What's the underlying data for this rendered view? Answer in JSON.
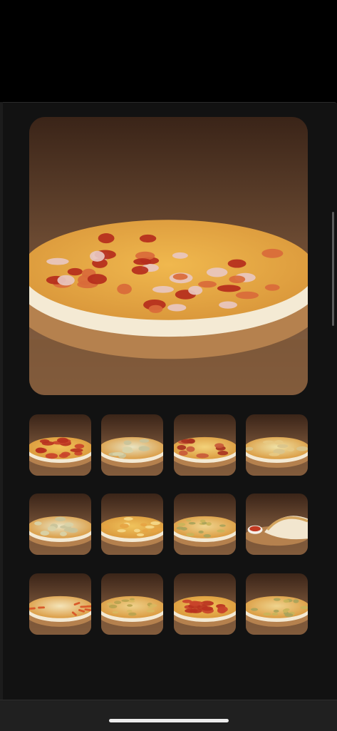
{
  "gallery": {
    "main_photo": {
      "icon": "pizza-photo",
      "topping": "pepperoni-onion"
    },
    "thumbnails": [
      {
        "icon": "pizza-photo",
        "topping": "pepperoni"
      },
      {
        "icon": "pizza-photo",
        "topping": "white-cheese"
      },
      {
        "icon": "pizza-photo",
        "topping": "salami"
      },
      {
        "icon": "pizza-photo",
        "topping": "four-cheese"
      },
      {
        "icon": "pizza-photo",
        "topping": "white-cheese"
      },
      {
        "icon": "pizza-photo",
        "topping": "cheese"
      },
      {
        "icon": "pizza-photo",
        "topping": "cheese-herb"
      },
      {
        "icon": "calzone-photo",
        "topping": "calzone"
      },
      {
        "icon": "pizza-photo",
        "topping": "sauce-stripes"
      },
      {
        "icon": "pizza-photo",
        "topping": "veggie"
      },
      {
        "icon": "pizza-photo",
        "topping": "pepperoni"
      },
      {
        "icon": "pizza-photo",
        "topping": "cheese-herb"
      }
    ]
  },
  "colors": {
    "background": "#000000",
    "sheet": "#121212",
    "home_indicator": "#ececec"
  }
}
